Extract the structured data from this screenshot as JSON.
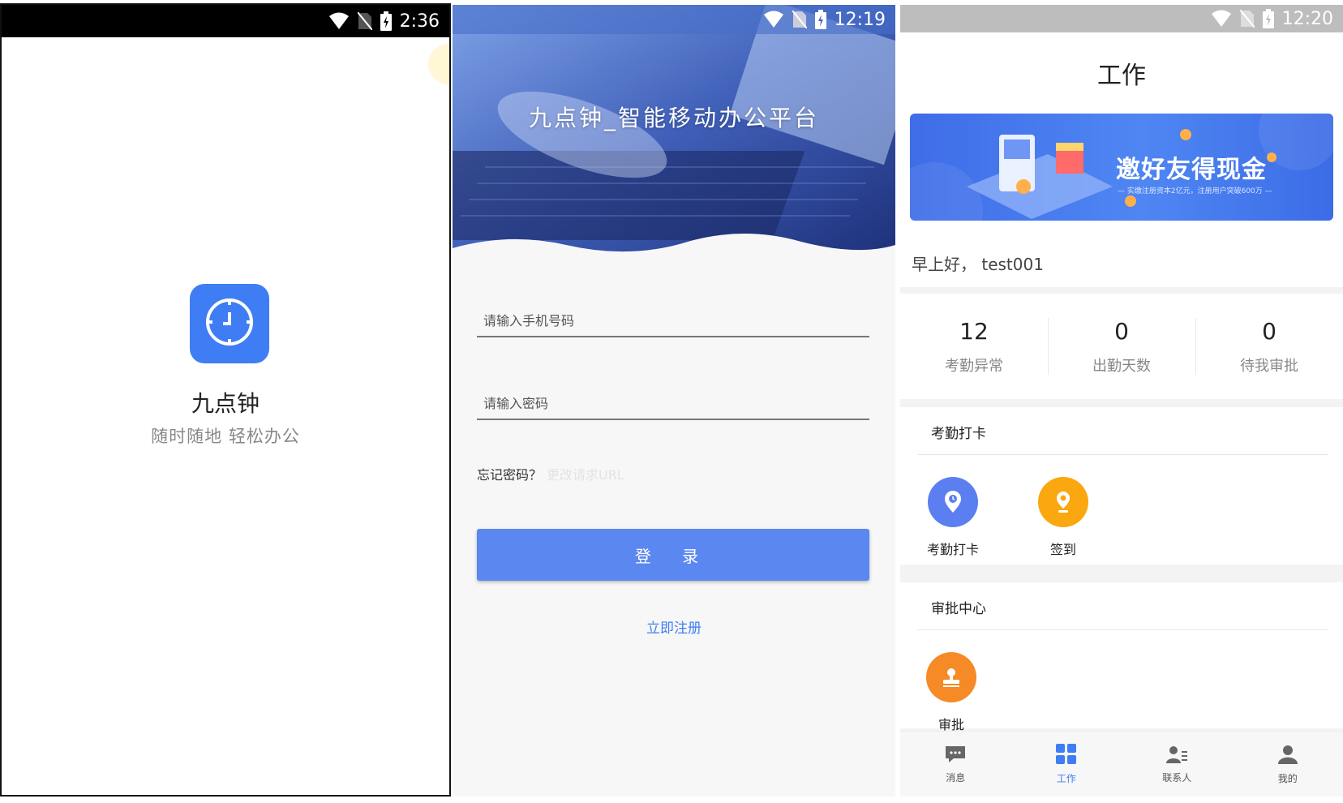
{
  "splash": {
    "status_time": "2:36",
    "app_name": "九点钟",
    "slogan": "随时随地 轻松办公",
    "icons": [
      "wifi-icon",
      "no-sim-icon",
      "battery-charging-icon",
      "clock-icon"
    ]
  },
  "login": {
    "status_time": "12:19",
    "hero_title": "九点钟_智能移动办公平台",
    "phone_placeholder": "请输入手机号码",
    "password_placeholder": "请输入密码",
    "forgot_label": "忘记密码？",
    "change_url_label": "更改请求URL",
    "login_button": "登 录",
    "register_link": "立即注册",
    "accent_color": "#5b87f0"
  },
  "work": {
    "status_time": "12:20",
    "title": "工作",
    "banner": {
      "title": "邀好友得现金",
      "subtitle": "— 实缴注册资本2亿元，注册用户突破600万 —"
    },
    "greeting": "早上好， test001",
    "stats": [
      {
        "value": "12",
        "label": "考勤异常"
      },
      {
        "value": "0",
        "label": "出勤天数"
      },
      {
        "value": "0",
        "label": "待我审批"
      }
    ],
    "attendance_section": {
      "title": "考勤打卡",
      "apps": [
        {
          "label": "考勤打卡",
          "icon": "clock-pin-icon",
          "color": "#5b7ff0"
        },
        {
          "label": "签到",
          "icon": "location-pin-icon",
          "color": "#fba70f"
        }
      ]
    },
    "approval_section": {
      "title": "审批中心",
      "apps": [
        {
          "label": "审批",
          "icon": "stamp-icon",
          "color": "#f58a26"
        }
      ]
    },
    "tabs": [
      {
        "label": "消息",
        "icon": "message-icon"
      },
      {
        "label": "工作",
        "icon": "grid-icon"
      },
      {
        "label": "联系人",
        "icon": "contacts-icon"
      },
      {
        "label": "我的",
        "icon": "person-icon"
      }
    ]
  }
}
